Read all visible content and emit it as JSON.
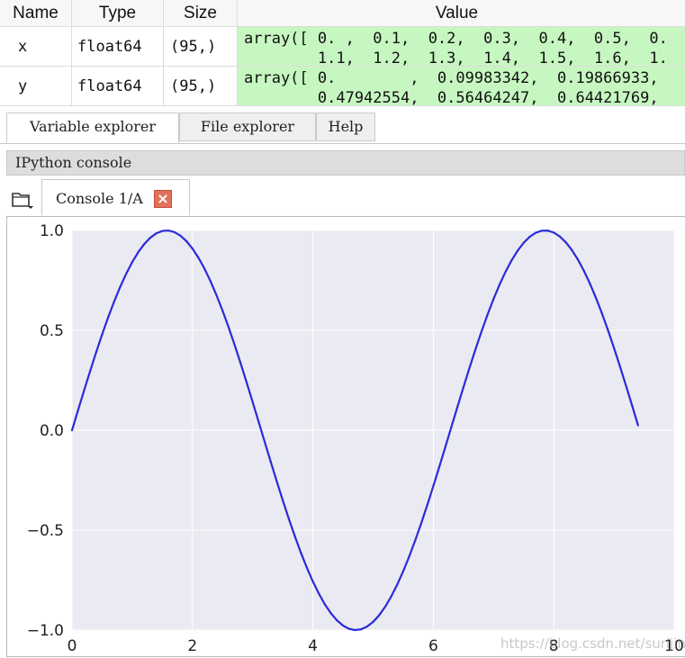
{
  "variable_explorer": {
    "columns": [
      "Name",
      "Type",
      "Size",
      "Value"
    ],
    "rows": [
      {
        "name": "x",
        "type": "float64",
        "size": "(95,)",
        "value_line1": "array([ 0. ,  0.1,  0.2,  0.3,  0.4,  0.5,  0.",
        "value_line2": "        1.1,  1.2,  1.3,  1.4,  1.5,  1.6,  1."
      },
      {
        "name": "y",
        "type": "float64",
        "size": "(95,)",
        "value_line1": "array([ 0.        ,  0.09983342,  0.19866933,",
        "value_line2": "        0.47942554,  0.56464247,  0.64421769,"
      }
    ],
    "value_bg_color": "#c7f7c1"
  },
  "pane_tabs": [
    {
      "label": "Variable explorer",
      "active": true
    },
    {
      "label": "File explorer",
      "active": false
    },
    {
      "label": "Help",
      "active": false
    }
  ],
  "console_pane": {
    "title": "IPython console",
    "tab_label": "Console 1/A",
    "browse_icon": "folder-icon",
    "close_icon": "close-icon"
  },
  "chart_data": {
    "type": "line",
    "function": "sin(x)",
    "x_start": 0.0,
    "x_step": 0.1,
    "n_points": 95,
    "xlim": [
      0,
      10
    ],
    "ylim": [
      -1.0,
      1.0
    ],
    "xticks": [
      "0",
      "2",
      "4",
      "6",
      "8",
      "10"
    ],
    "yticks": [
      "1.0",
      "0.5",
      "0.0",
      "−0.5",
      "−1.0"
    ],
    "xtick_values": [
      0,
      2,
      4,
      6,
      8,
      10
    ],
    "ytick_values": [
      1.0,
      0.5,
      0.0,
      -0.5,
      -1.0
    ],
    "grid": true,
    "line_color": "#2b2bd9",
    "background_color": "#eaeaf2"
  },
  "watermark": "https://blog.csdn.net/surijing"
}
